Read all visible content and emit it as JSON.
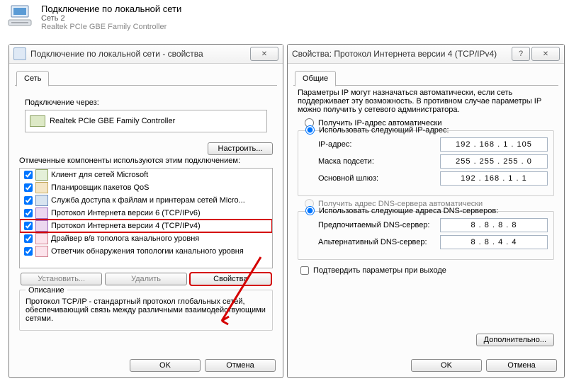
{
  "header": {
    "title": "Подключение по локальной сети",
    "sub1": "Сеть 2",
    "sub2": "Realtek PCIe GBE Family Controller"
  },
  "dlg1": {
    "title": "Подключение по локальной сети - свойства",
    "tab": "Сеть",
    "connect_using": "Подключение через:",
    "adapter": "Realtek PCIe GBE Family Controller",
    "configure_btn": "Настроить...",
    "components_label": "Отмеченные компоненты используются этим подключением:",
    "items": [
      {
        "label": "Клиент для сетей Microsoft"
      },
      {
        "label": "Планировщик пакетов QoS"
      },
      {
        "label": "Служба доступа к файлам и принтерам сетей Micro..."
      },
      {
        "label": "Протокол Интернета версии 6 (TCP/IPv6)"
      },
      {
        "label": "Протокол Интернета версии 4 (TCP/IPv4)"
      },
      {
        "label": "Драйвер в/в тополога канального уровня"
      },
      {
        "label": "Ответчик обнаружения топологии канального уровня"
      }
    ],
    "install_btn": "Установить...",
    "remove_btn": "Удалить",
    "props_btn": "Свойства",
    "desc_label": "Описание",
    "desc_text": "Протокол TCP/IP - стандартный протокол глобальных сетей, обеспечивающий связь между различными взаимодействующими сетями.",
    "ok": "OK",
    "cancel": "Отмена"
  },
  "dlg2": {
    "title": "Свойства: Протокол Интернета версии 4 (TCP/IPv4)",
    "tab": "Общие",
    "note": "Параметры IP могут назначаться автоматически, если сеть поддерживает эту возможность. В противном случае параметры IP можно получить у сетевого администратора.",
    "auto_ip": "Получить IP-адрес автоматически",
    "manual_ip": "Использовать следующий IP-адрес:",
    "ip_label": "IP-адрес:",
    "ip_value": "192 . 168 .  1  . 105",
    "mask_label": "Маска подсети:",
    "mask_value": "255 . 255 . 255 .  0",
    "gw_label": "Основной шлюз:",
    "gw_value": "192 . 168 .  1  .  1",
    "auto_dns": "Получить адрес DNS-сервера автоматически",
    "manual_dns": "Использовать следующие адреса DNS-серверов:",
    "dns1_label": "Предпочитаемый DNS-сервер:",
    "dns1_value": "8  .  8  .  8  .  8",
    "dns2_label": "Альтернативный DNS-сервер:",
    "dns2_value": "8  .  8  .  4  .  4",
    "confirm_exit": "Подтвердить параметры при выходе",
    "advanced": "Дополнительно...",
    "ok": "OK",
    "cancel": "Отмена"
  }
}
